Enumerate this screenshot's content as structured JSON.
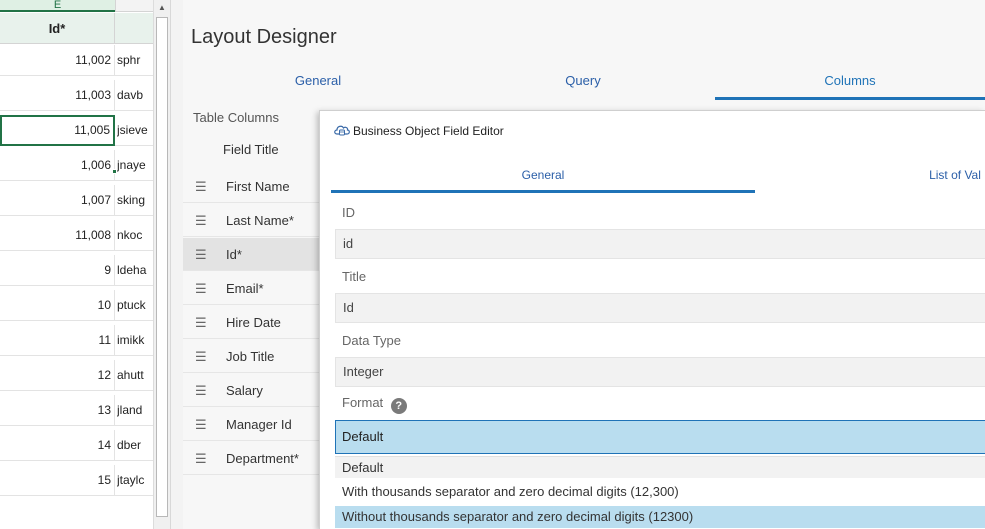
{
  "sheet": {
    "column_letter": "E",
    "column_header": "Id*",
    "rows": [
      {
        "id": "11,002",
        "user": "sphr"
      },
      {
        "id": "11,003",
        "user": "davb"
      },
      {
        "id": "11,005",
        "user": "jsieve"
      },
      {
        "id": "1,006",
        "user": "jnaye"
      },
      {
        "id": "1,007",
        "user": "sking"
      },
      {
        "id": "11,008",
        "user": "nkoc"
      },
      {
        "id": "9",
        "user": "ldeha"
      },
      {
        "id": "10",
        "user": "ptuck"
      },
      {
        "id": "11",
        "user": "imikk"
      },
      {
        "id": "12",
        "user": "ahutt"
      },
      {
        "id": "13",
        "user": "jland"
      },
      {
        "id": "14",
        "user": "dber"
      },
      {
        "id": "15",
        "user": "jtaylc"
      }
    ],
    "selected_row_index": 2,
    "scroll_up_glyph": "▲"
  },
  "designer": {
    "title": "Layout Designer",
    "tabs": [
      {
        "label": "General"
      },
      {
        "label": "Query"
      },
      {
        "label": "Columns"
      }
    ],
    "active_tab": "Columns",
    "table_columns_label": "Table Columns",
    "field_title_header": "Field Title",
    "drag_glyph": "☰",
    "columns": [
      {
        "label": "First Name"
      },
      {
        "label": "Last Name*"
      },
      {
        "label": "Id*"
      },
      {
        "label": "Email*"
      },
      {
        "label": "Hire Date"
      },
      {
        "label": "Job Title"
      },
      {
        "label": "Salary"
      },
      {
        "label": "Manager Id"
      },
      {
        "label": "Department*"
      }
    ],
    "highlighted_column": "Id*"
  },
  "dialog": {
    "icon": "cloud-database-icon",
    "title": "Business Object Field Editor",
    "tabs": [
      {
        "label": "General"
      },
      {
        "label": "List of Val"
      }
    ],
    "active_tab": "General",
    "fields": {
      "id_label": "ID",
      "id_value": "id",
      "title_label": "Title",
      "title_value": "Id",
      "data_type_label": "Data Type",
      "data_type_value": "Integer",
      "format_label": "Format",
      "format_help_glyph": "?",
      "format_value": "Default"
    },
    "format_options": [
      "Default",
      "With thousands separator and zero decimal digits (12,300)",
      "Without thousands separator and zero decimal digits (12300)"
    ],
    "hovered_option": "Without thousands separator and zero decimal digits (12300)"
  },
  "colors": {
    "excel_green": "#217346",
    "accent_blue": "#1f73b7",
    "selection_blue": "#b9ddef"
  }
}
